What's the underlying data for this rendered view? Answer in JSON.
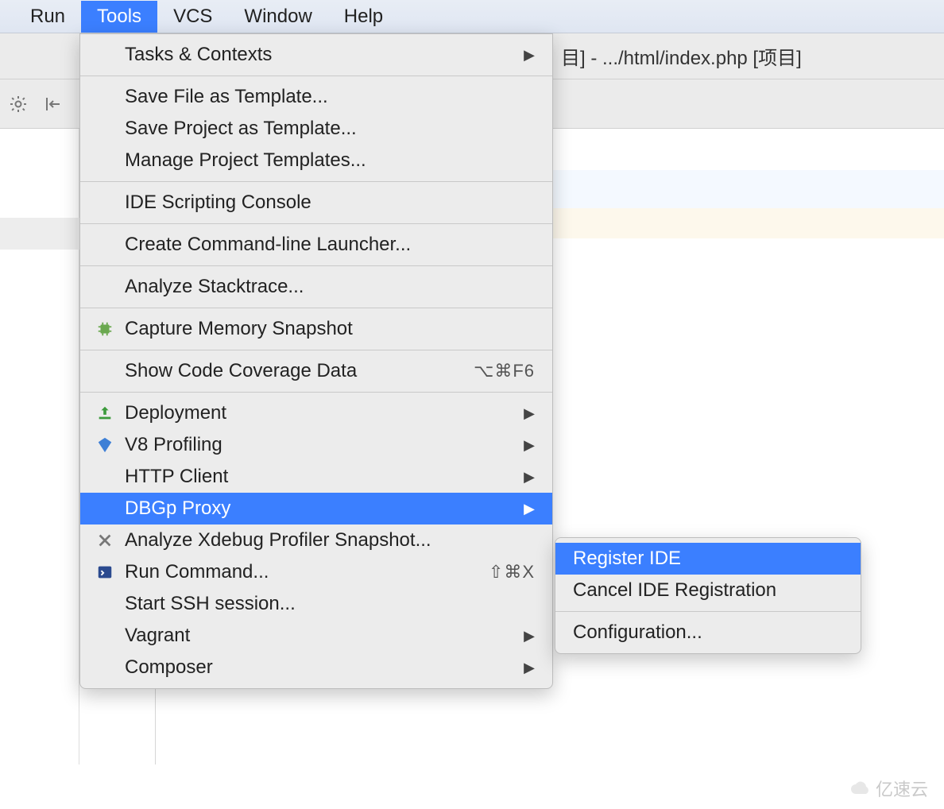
{
  "menubar": {
    "items": [
      "Run",
      "Tools",
      "VCS",
      "Window",
      "Help"
    ],
    "active_index": 1
  },
  "title_fragment": "目] - .../html/index.php [项目]",
  "tools_menu": {
    "items": [
      {
        "label": "Tasks & Contexts",
        "icon": null,
        "submenu": true
      },
      {
        "sep": true
      },
      {
        "label": "Save File as Template...",
        "icon": null
      },
      {
        "label": "Save Project as Template...",
        "icon": null
      },
      {
        "label": "Manage Project Templates...",
        "icon": null
      },
      {
        "sep": true
      },
      {
        "label": "IDE Scripting Console",
        "icon": null
      },
      {
        "sep": true
      },
      {
        "label": "Create Command-line Launcher...",
        "icon": null
      },
      {
        "sep": true
      },
      {
        "label": "Analyze Stacktrace...",
        "icon": null
      },
      {
        "sep": true
      },
      {
        "label": "Capture Memory Snapshot",
        "icon": "chip"
      },
      {
        "sep": true
      },
      {
        "label": "Show Code Coverage Data",
        "icon": null,
        "shortcut": "⌥⌘F6"
      },
      {
        "sep": true
      },
      {
        "label": "Deployment",
        "icon": "deploy",
        "submenu": true
      },
      {
        "label": "V8 Profiling",
        "icon": "v8",
        "submenu": true
      },
      {
        "label": "HTTP Client",
        "icon": null,
        "submenu": true
      },
      {
        "label": "DBGp Proxy",
        "icon": null,
        "submenu": true,
        "highlighted": true
      },
      {
        "label": "Analyze Xdebug Profiler Snapshot...",
        "icon": "cross"
      },
      {
        "label": "Run Command...",
        "icon": "terminal",
        "shortcut": "⇧⌘X"
      },
      {
        "label": "Start SSH session...",
        "icon": null
      },
      {
        "label": "Vagrant",
        "icon": null,
        "submenu": true
      },
      {
        "label": "Composer",
        "icon": null,
        "submenu": true
      }
    ]
  },
  "submenu": {
    "items": [
      {
        "label": "Register IDE",
        "highlighted": true
      },
      {
        "label": "Cancel IDE Registration"
      },
      {
        "sep": true
      },
      {
        "label": "Configuration..."
      }
    ]
  },
  "watermark": "亿速云"
}
